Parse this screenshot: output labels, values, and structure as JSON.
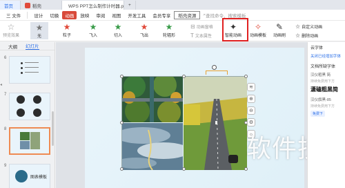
{
  "tabs": [
    {
      "label": "首页"
    },
    {
      "label": "稻壳"
    },
    {
      "label": "WPS PPT怎么制作计时器.pptx"
    }
  ],
  "menu": {
    "file": "三 文件",
    "items": [
      "设计",
      "切换",
      "动画",
      "放映",
      "审阅",
      "视图",
      "开发工具",
      "会员专享",
      "稻壳资源"
    ],
    "search": "查找命令、搜索模板"
  },
  "ribbon": {
    "preview": "预览效果",
    "none": "无",
    "bounce": "粒子",
    "flyin": "飞入",
    "cutin": "切入",
    "flyout": "飞出",
    "wheel": "轮辐形",
    "anim_window": "动画窗格",
    "text_effect": "文本属性",
    "smart_anim": "智能动画",
    "anim_template": "动画模板",
    "anim_brush": "动画刷",
    "delete_anim": "删除动画",
    "custom": "自定义动画"
  },
  "leftpanel": {
    "tab_outline": "大纲",
    "tab_slides": "幻灯片",
    "slides": [
      {
        "num": "6"
      },
      {
        "num": "7"
      },
      {
        "num": "8"
      },
      {
        "num": "9",
        "label": "图表模板"
      }
    ]
  },
  "rightpanel": {
    "title": "云字体",
    "link": "关闭已经增加字体",
    "section": "文档所缺字体",
    "item1": "汉仪粗黑 简",
    "item1_sub": "持续免费用下方",
    "big": "潇磕粗黑简",
    "item2": "汉仪旗黑-85",
    "item2_sub": "持续免费用下方",
    "pill": "免费下"
  },
  "watermark": "软件技巧",
  "colors": {
    "accent": "#d84a3a",
    "highlight_box": "#e02020",
    "link": "#2b6fe8"
  }
}
